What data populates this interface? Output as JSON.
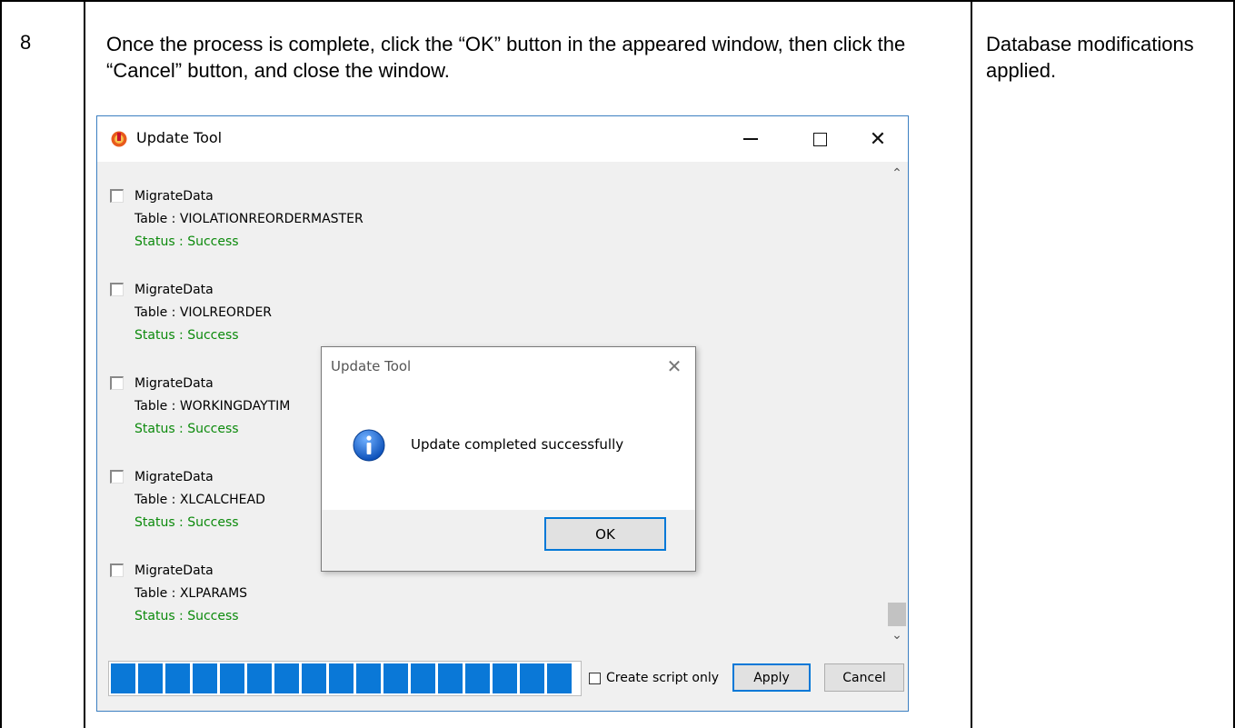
{
  "document": {
    "step_number": "8",
    "instruction": "Once the process is complete, click the “OK” button in the appeared window, then click the “Cancel” button, and close the window.",
    "result": "Database modifications applied."
  },
  "window": {
    "title": "Update Tool",
    "items": [
      {
        "action": "MigrateData",
        "table": "Table : VIOLATIONREORDERMASTER",
        "status": "Status : Success"
      },
      {
        "action": "MigrateData",
        "table": "Table : VIOLREORDER",
        "status": "Status : Success"
      },
      {
        "action": "MigrateData",
        "table": "Table : WORKINGDAYTIM",
        "status": "Status : Success"
      },
      {
        "action": "MigrateData",
        "table": "Table : XLCALCHEAD",
        "status": "Status : Success"
      },
      {
        "action": "MigrateData",
        "table": "Table : XLPARAMS",
        "status": "Status : Success"
      }
    ],
    "progress_fraction": 1.0,
    "create_script_only_label": "Create script only",
    "apply_label": "Apply",
    "cancel_label": "Cancel"
  },
  "dialog": {
    "title": "Update Tool",
    "message": "Update completed successfully",
    "ok_label": "OK"
  },
  "colors": {
    "status_success": "#0c8a0c",
    "progress_fill": "#0a78d7",
    "window_border": "#3c7fc1"
  },
  "icons": [
    "app-logo-icon",
    "minimize-icon",
    "maximize-icon",
    "close-icon",
    "scroll-up-icon",
    "scroll-down-icon",
    "info-icon"
  ]
}
